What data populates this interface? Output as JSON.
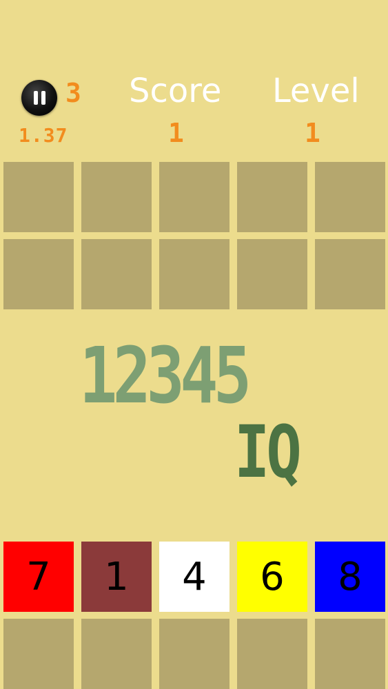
{
  "hud": {
    "pause_icon": "pause-icon",
    "lives": "3",
    "timer": "1.37",
    "score_label": "Score",
    "score_value": "1",
    "level_label": "Level",
    "level_value": "1"
  },
  "board": {
    "sequence": "12345",
    "iq_label": "IQ"
  },
  "tiles": [
    {
      "number": "7",
      "color": "#ff0000"
    },
    {
      "number": "1",
      "color": "#8b3a3a"
    },
    {
      "number": "4",
      "color": "#ffffff"
    },
    {
      "number": "6",
      "color": "#ffff00"
    },
    {
      "number": "8",
      "color": "#0000ff"
    }
  ],
  "colors": {
    "background": "#ecdc8d",
    "empty_cell": "#b5a76e",
    "hud_accent": "#f28c1e",
    "sequence_text": "#7d9f73",
    "iq_text": "#4c7343"
  }
}
